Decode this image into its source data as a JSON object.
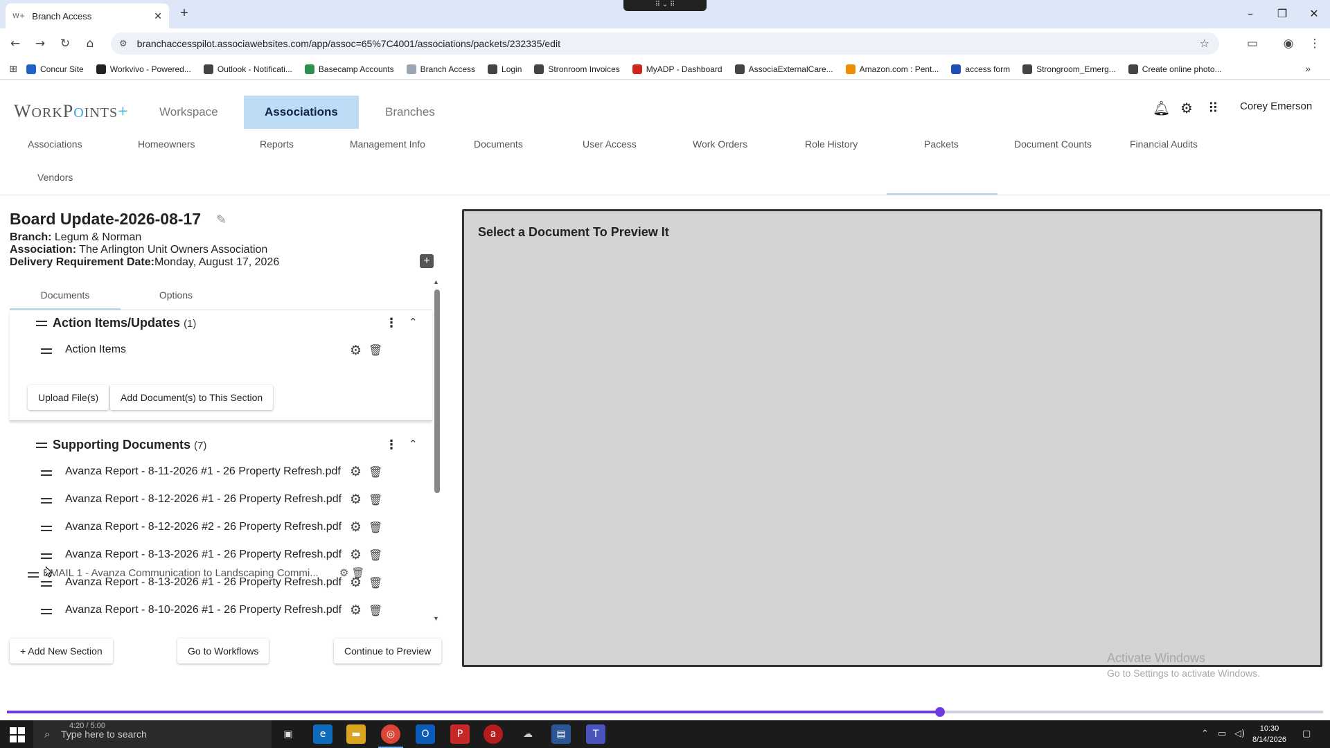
{
  "browser": {
    "tab_title": "Branch Access",
    "tab_favicon": "W+",
    "url": "branchaccesspilot.associawebsites.com/app/assoc=65%7C4001/associations/packets/232335/edit",
    "bookmarks": [
      {
        "label": "Concur Site",
        "color": "#1f63c6"
      },
      {
        "label": "Workvivo - Powered...",
        "color": "#222222"
      },
      {
        "label": "Outlook - Notificati...",
        "color": "#444444"
      },
      {
        "label": "Basecamp Accounts",
        "color": "#2f8f4e"
      },
      {
        "label": "Branch Access",
        "color": "#9aa4b2"
      },
      {
        "label": "Login",
        "color": "#444444"
      },
      {
        "label": "Stronroom Invoices",
        "color": "#444444"
      },
      {
        "label": "MyADP - Dashboard",
        "color": "#d0271d"
      },
      {
        "label": "AssociaExternalCare...",
        "color": "#444444"
      },
      {
        "label": "Amazon.com : Pent...",
        "color": "#f08c00"
      },
      {
        "label": "access form",
        "color": "#1c4fb8"
      },
      {
        "label": "Strongroom_Emerg...",
        "color": "#444444"
      },
      {
        "label": "Create online photo...",
        "color": "#444444"
      }
    ]
  },
  "app": {
    "logo": {
      "w": "W",
      "ork": "ORK",
      "p": "P",
      "o": "O",
      "ints": "INTS",
      "plus": "+"
    },
    "top_nav": [
      "Workspace",
      "Associations",
      "Branches"
    ],
    "user_name": "Corey Emerson",
    "sub_nav": [
      "Associations",
      "Homeowners",
      "Reports",
      "Management Info",
      "Documents",
      "User Access",
      "Work Orders",
      "Role History",
      "Packets",
      "Document Counts",
      "Financial Audits",
      "Vendors"
    ]
  },
  "packet": {
    "title": "Board Update-2026-08-17",
    "branch_label": "Branch:",
    "branch_value": "Legum & Norman",
    "association_label": "Association:",
    "association_value": "The Arlington Unit Owners Association",
    "delivery_label": "Delivery Requirement Date:",
    "delivery_value": "Monday, August 17, 2026",
    "tabs": [
      "Documents",
      "Options"
    ]
  },
  "sections": [
    {
      "name": "Action Items/Updates",
      "count": "(1)",
      "documents": [
        "Action Items"
      ],
      "upload_label": "Upload File(s)",
      "add_docs_label": "Add Document(s) to This Section"
    },
    {
      "name": "Supporting Documents",
      "count": "(7)",
      "documents": [
        "Avanza Report - 8-11-2026 #1 - 26 Property Refresh.pdf",
        "Avanza Report - 8-12-2026 #1 - 26 Property Refresh.pdf",
        "Avanza Report - 8-12-2026 #2 - 26 Property Refresh.pdf",
        "Avanza Report - 8-13-2026 #1 - 26 Property Refresh.pdf",
        "Avanza Report - 8-13-2026 #1 - 26 Property Refresh.pdf",
        "Avanza Report - 8-10-2026 #1 - 26 Property Refresh.pdf"
      ],
      "dragging_item": "EMAIL 1 - Avanza Communication to Landscaping Commi..."
    }
  ],
  "footer_buttons": {
    "add_section": "+ Add New Section",
    "workflows": "Go to Workflows",
    "continue": "Continue to Preview"
  },
  "preview": {
    "placeholder": "Select a Document To Preview It"
  },
  "watermark": {
    "line1": "Activate Windows",
    "line2": "Go to Settings to activate Windows."
  },
  "video": {
    "time": "4:20 / 5:00",
    "progress": 0.709
  },
  "taskbar": {
    "search_placeholder": "Type here to search",
    "time": "10:30",
    "date": "8/14/2026"
  },
  "colors": {
    "accent_nav": "#bddcf6",
    "progress": "#6e3adf",
    "preview_bg": "#d4d4d4"
  }
}
